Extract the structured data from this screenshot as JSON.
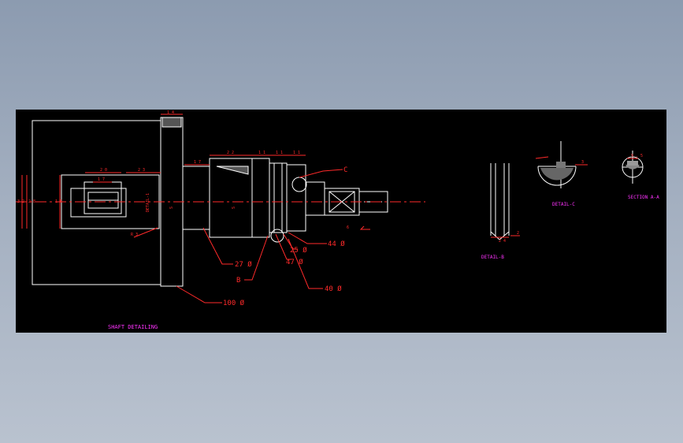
{
  "drawing": {
    "title": "SHAFT DETAILING",
    "callouts": {
      "c": "C",
      "d44": "44 Ø",
      "d25": "25 Ø",
      "d47": "47 Ø",
      "d27": "27 Ø",
      "b": "B",
      "d40": "40 Ø",
      "d100": "100 Ø",
      "a": "A"
    },
    "views": {
      "detail_b": "DETAIL-B",
      "detail_c": "DETAIL-C",
      "section_a": "SECTION A-A"
    },
    "small_dims": {
      "top_14": "1 4",
      "dim_17": "1 7",
      "dim_22": "2 2",
      "dim_11a": "1 1",
      "dim_11b": "1 1",
      "dim_11c": "1 1",
      "dim_20": "2 0",
      "dim_17b": "1 7",
      "dim_23": "2 3",
      "dim_32": "3 2",
      "dim_28": "2 8",
      "dim_16": "1 6",
      "dim_2": "2",
      "dim_24": "2 4",
      "dim_R3": "R 3",
      "dim_3": "3",
      "dim_16c": "1 6",
      "dim_9b": "9 . 5",
      "shaft_lbl1": "DETAIL-1",
      "shaft_lbl2": "S",
      "shaft_lbl3": "S",
      "dim_6": "6"
    }
  },
  "colors": {
    "line": "#ffffff",
    "dim": "#ff2a2a",
    "label": "#ff33ff",
    "background": "#000000"
  }
}
